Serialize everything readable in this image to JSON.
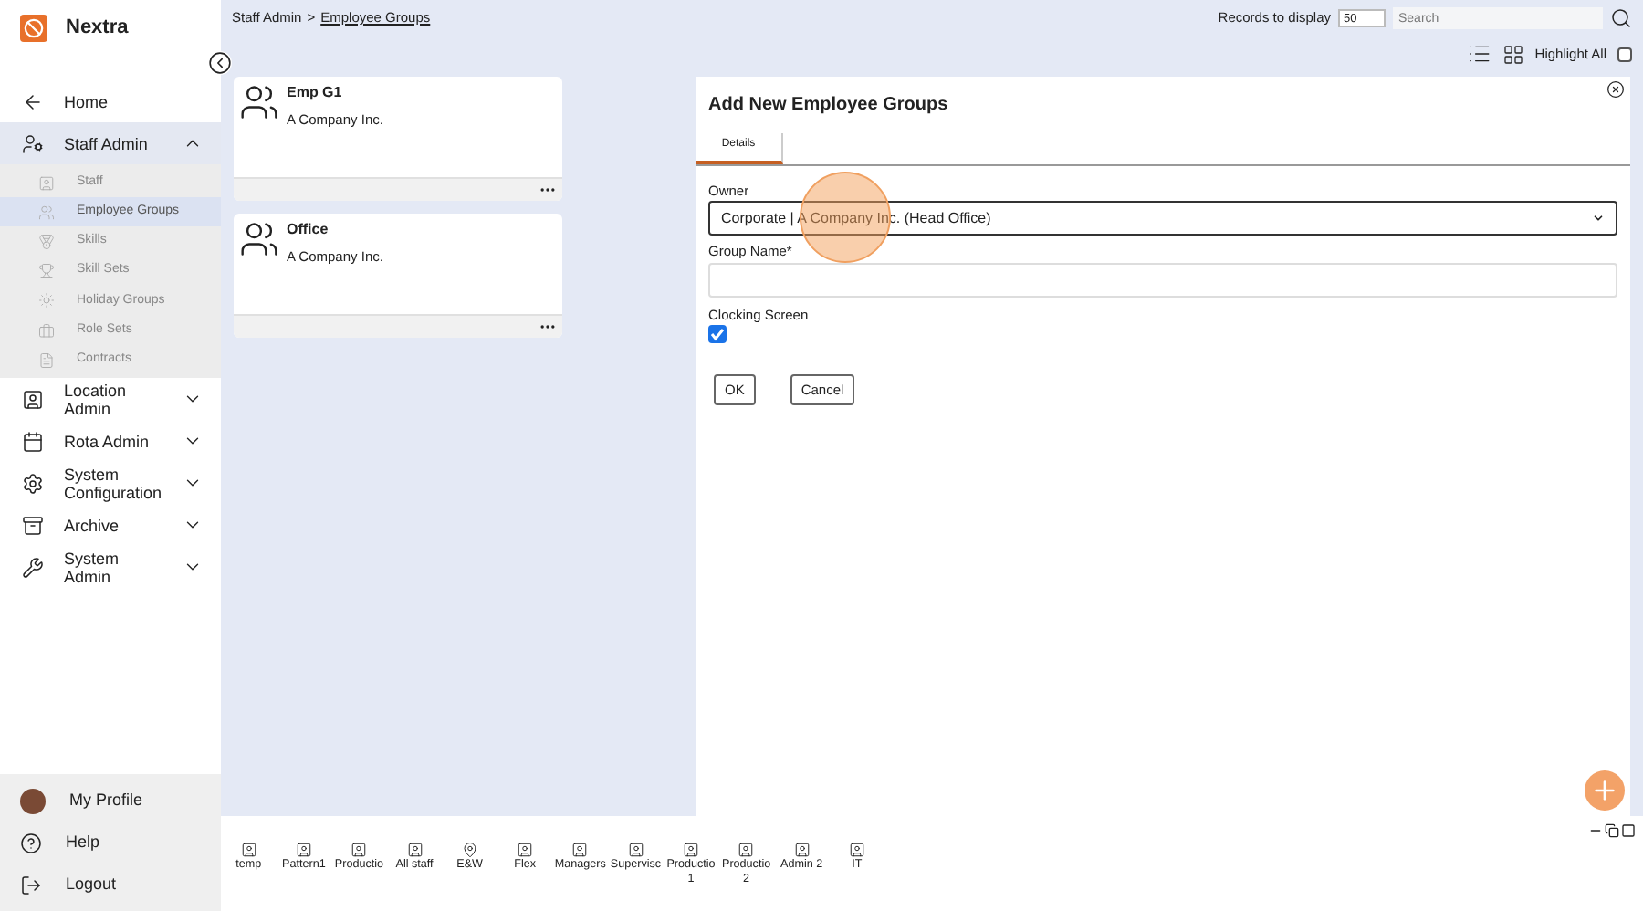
{
  "app": {
    "name": "Nextra"
  },
  "breadcrumb": {
    "parent": "Staff Admin",
    "separator": ">",
    "current": "Employee Groups"
  },
  "nav": [
    {
      "kind": "home",
      "label": "Home",
      "selected": false
    },
    {
      "kind": "staff",
      "label": "Staff Admin",
      "selected": true,
      "expanded": true,
      "children": [
        {
          "kind": "staff",
          "label": "Staff",
          "selected": false
        },
        {
          "kind": "groups",
          "label": "Employee Groups",
          "selected": true
        },
        {
          "kind": "skills",
          "label": "Skills",
          "selected": false
        },
        {
          "kind": "skillsets",
          "label": "Skill Sets",
          "selected": false
        },
        {
          "kind": "holiday",
          "label": "Holiday Groups",
          "selected": false
        },
        {
          "kind": "roles",
          "label": "Role Sets",
          "selected": false
        },
        {
          "kind": "contracts",
          "label": "Contracts",
          "selected": false
        }
      ]
    },
    {
      "kind": "location",
      "label": "Location Admin",
      "selected": false,
      "expanded": false
    },
    {
      "kind": "rota",
      "label": "Rota Admin",
      "selected": false,
      "expanded": false
    },
    {
      "kind": "config",
      "label": "System Configuration",
      "selected": false,
      "expanded": false
    },
    {
      "kind": "archive",
      "label": "Archive",
      "selected": false,
      "expanded": false
    },
    {
      "kind": "sysadmin",
      "label": "System Admin",
      "selected": false,
      "expanded": false
    }
  ],
  "footer_nav": [
    {
      "kind": "profile",
      "label": "My Profile"
    },
    {
      "kind": "help",
      "label": "Help"
    },
    {
      "kind": "logout",
      "label": "Logout"
    }
  ],
  "toolbar": {
    "records_label": "Records to display",
    "records_value": "50",
    "search_placeholder": "Search",
    "highlight_label": "Highlight All",
    "highlight_checked": false
  },
  "groups": [
    {
      "name": "Emp G1",
      "company": "A Company Inc."
    },
    {
      "name": "Office",
      "company": "A Company Inc."
    }
  ],
  "dialog": {
    "title": "Add New Employee Groups",
    "tabs": [
      {
        "label": "Details",
        "selected": true
      }
    ],
    "owner_label": "Owner",
    "owner_value": "Corporate | A Company Inc. (Head Office)",
    "group_name_label": "Group Name*",
    "clocking_label": "Clocking Screen",
    "clocking_checked": true,
    "buttons": [
      "OK",
      "Cancel"
    ]
  },
  "bottom_groups": [
    {
      "kind": "person",
      "label": "temp"
    },
    {
      "kind": "person",
      "label": "Pattern1"
    },
    {
      "kind": "person",
      "label": "Productio"
    },
    {
      "kind": "person",
      "label": "All staff"
    },
    {
      "kind": "location",
      "label": "E&W"
    },
    {
      "kind": "person",
      "label": "Flex"
    },
    {
      "kind": "person",
      "label": "Managers"
    },
    {
      "kind": "person",
      "label": "Supervisc"
    },
    {
      "kind": "person",
      "label": "Productio 1"
    },
    {
      "kind": "person",
      "label": "Productio 2"
    },
    {
      "kind": "person",
      "label": "Admin 2"
    },
    {
      "kind": "person",
      "label": "IT"
    }
  ]
}
